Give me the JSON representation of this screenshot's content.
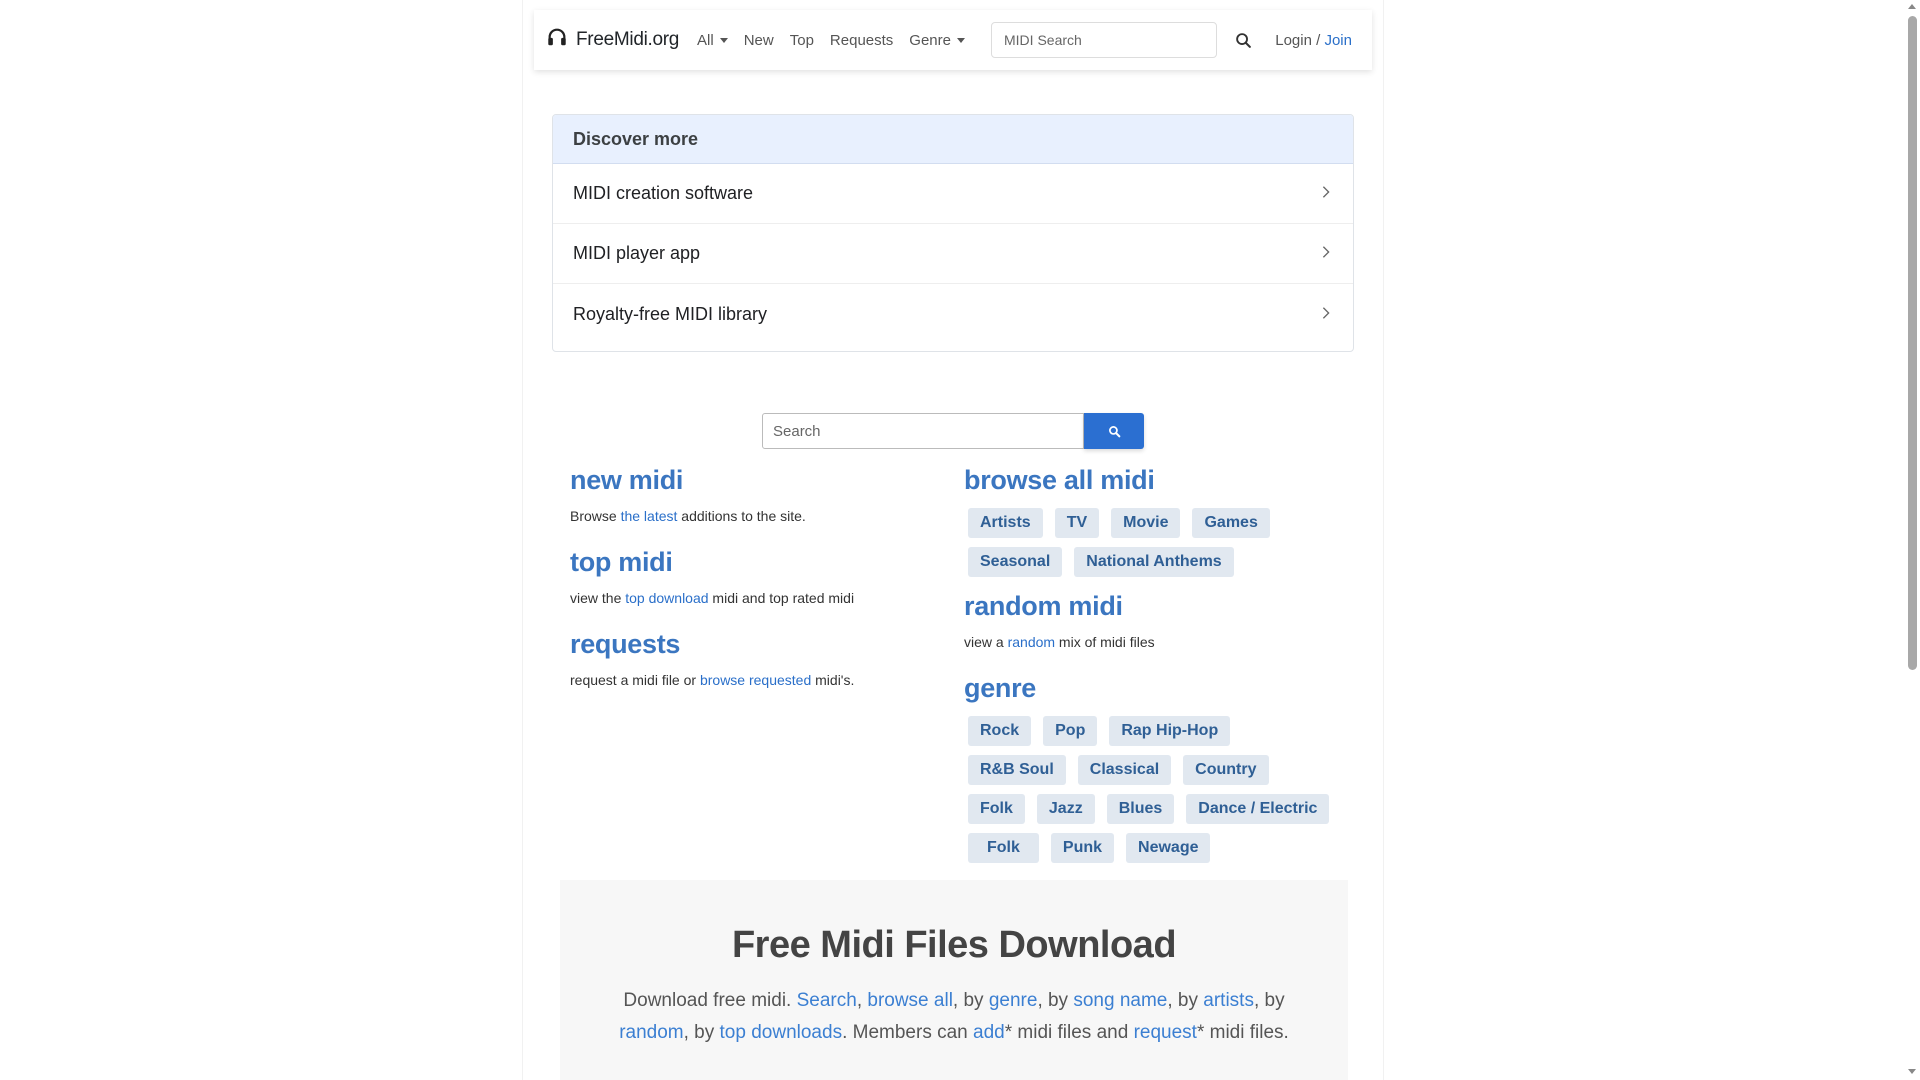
{
  "navbar": {
    "brand": "FreeMidi.org",
    "items": [
      "All",
      "New",
      "Top",
      "Requests",
      "Genre"
    ],
    "search_placeholder": "MIDI Search",
    "login": "Login /",
    "join": "Join"
  },
  "discover": {
    "title": "Discover more",
    "items": [
      "MIDI creation software",
      "MIDI player app",
      "Royalty-free MIDI library"
    ]
  },
  "main_search": {
    "placeholder": "Search"
  },
  "left": {
    "new_title": "new midi",
    "new_desc_pre": "Browse ",
    "new_desc_link": "the latest",
    "new_desc_post": " additions to the site.",
    "top_title": "top midi",
    "top_desc_pre": "view the ",
    "top_desc_link": "top download",
    "top_desc_post": " midi and top rated midi",
    "req_title": "requests",
    "req_desc_pre": "request a midi file or ",
    "req_desc_link": "browse requested",
    "req_desc_post": " midi's."
  },
  "right": {
    "browse_title": "browse all midi",
    "browse_tags": [
      "Artists",
      "TV",
      "Movie",
      "Games",
      "Seasonal",
      "National Anthems"
    ],
    "random_title": "random midi",
    "random_desc_pre": "view a ",
    "random_desc_link": "random",
    "random_desc_post": " mix of midi files",
    "genre_title": "genre",
    "genre_tags": [
      "Rock",
      "Pop",
      "Rap Hip-Hop",
      "R&B Soul",
      "Classical",
      "Country",
      "Folk",
      "Jazz",
      "Blues",
      "Dance / Electric",
      "Folk",
      "Punk",
      "Newage"
    ]
  },
  "jumbo": {
    "title": "Free Midi Files Download",
    "t1": "Download free midi. ",
    "l_search": "Search",
    "t2": ", ",
    "l_browse": "browse all",
    "t3": ", by ",
    "l_genre": "genre",
    "t4": ", by ",
    "l_song": "song name",
    "t5": ", by ",
    "l_artists": "artists",
    "t6": ", by ",
    "l_random": "random",
    "t7": ", by ",
    "l_top": "top downloads",
    "t8": ". Members can ",
    "l_add": "add",
    "t9": "* midi files and ",
    "l_request": "request",
    "t10": "* midi files."
  },
  "colors": {
    "accent": "#2b6fd1",
    "title_blue": "#3b76c0",
    "tag_bg": "#e1e8f0",
    "discover_head": "#e8f0fe"
  }
}
